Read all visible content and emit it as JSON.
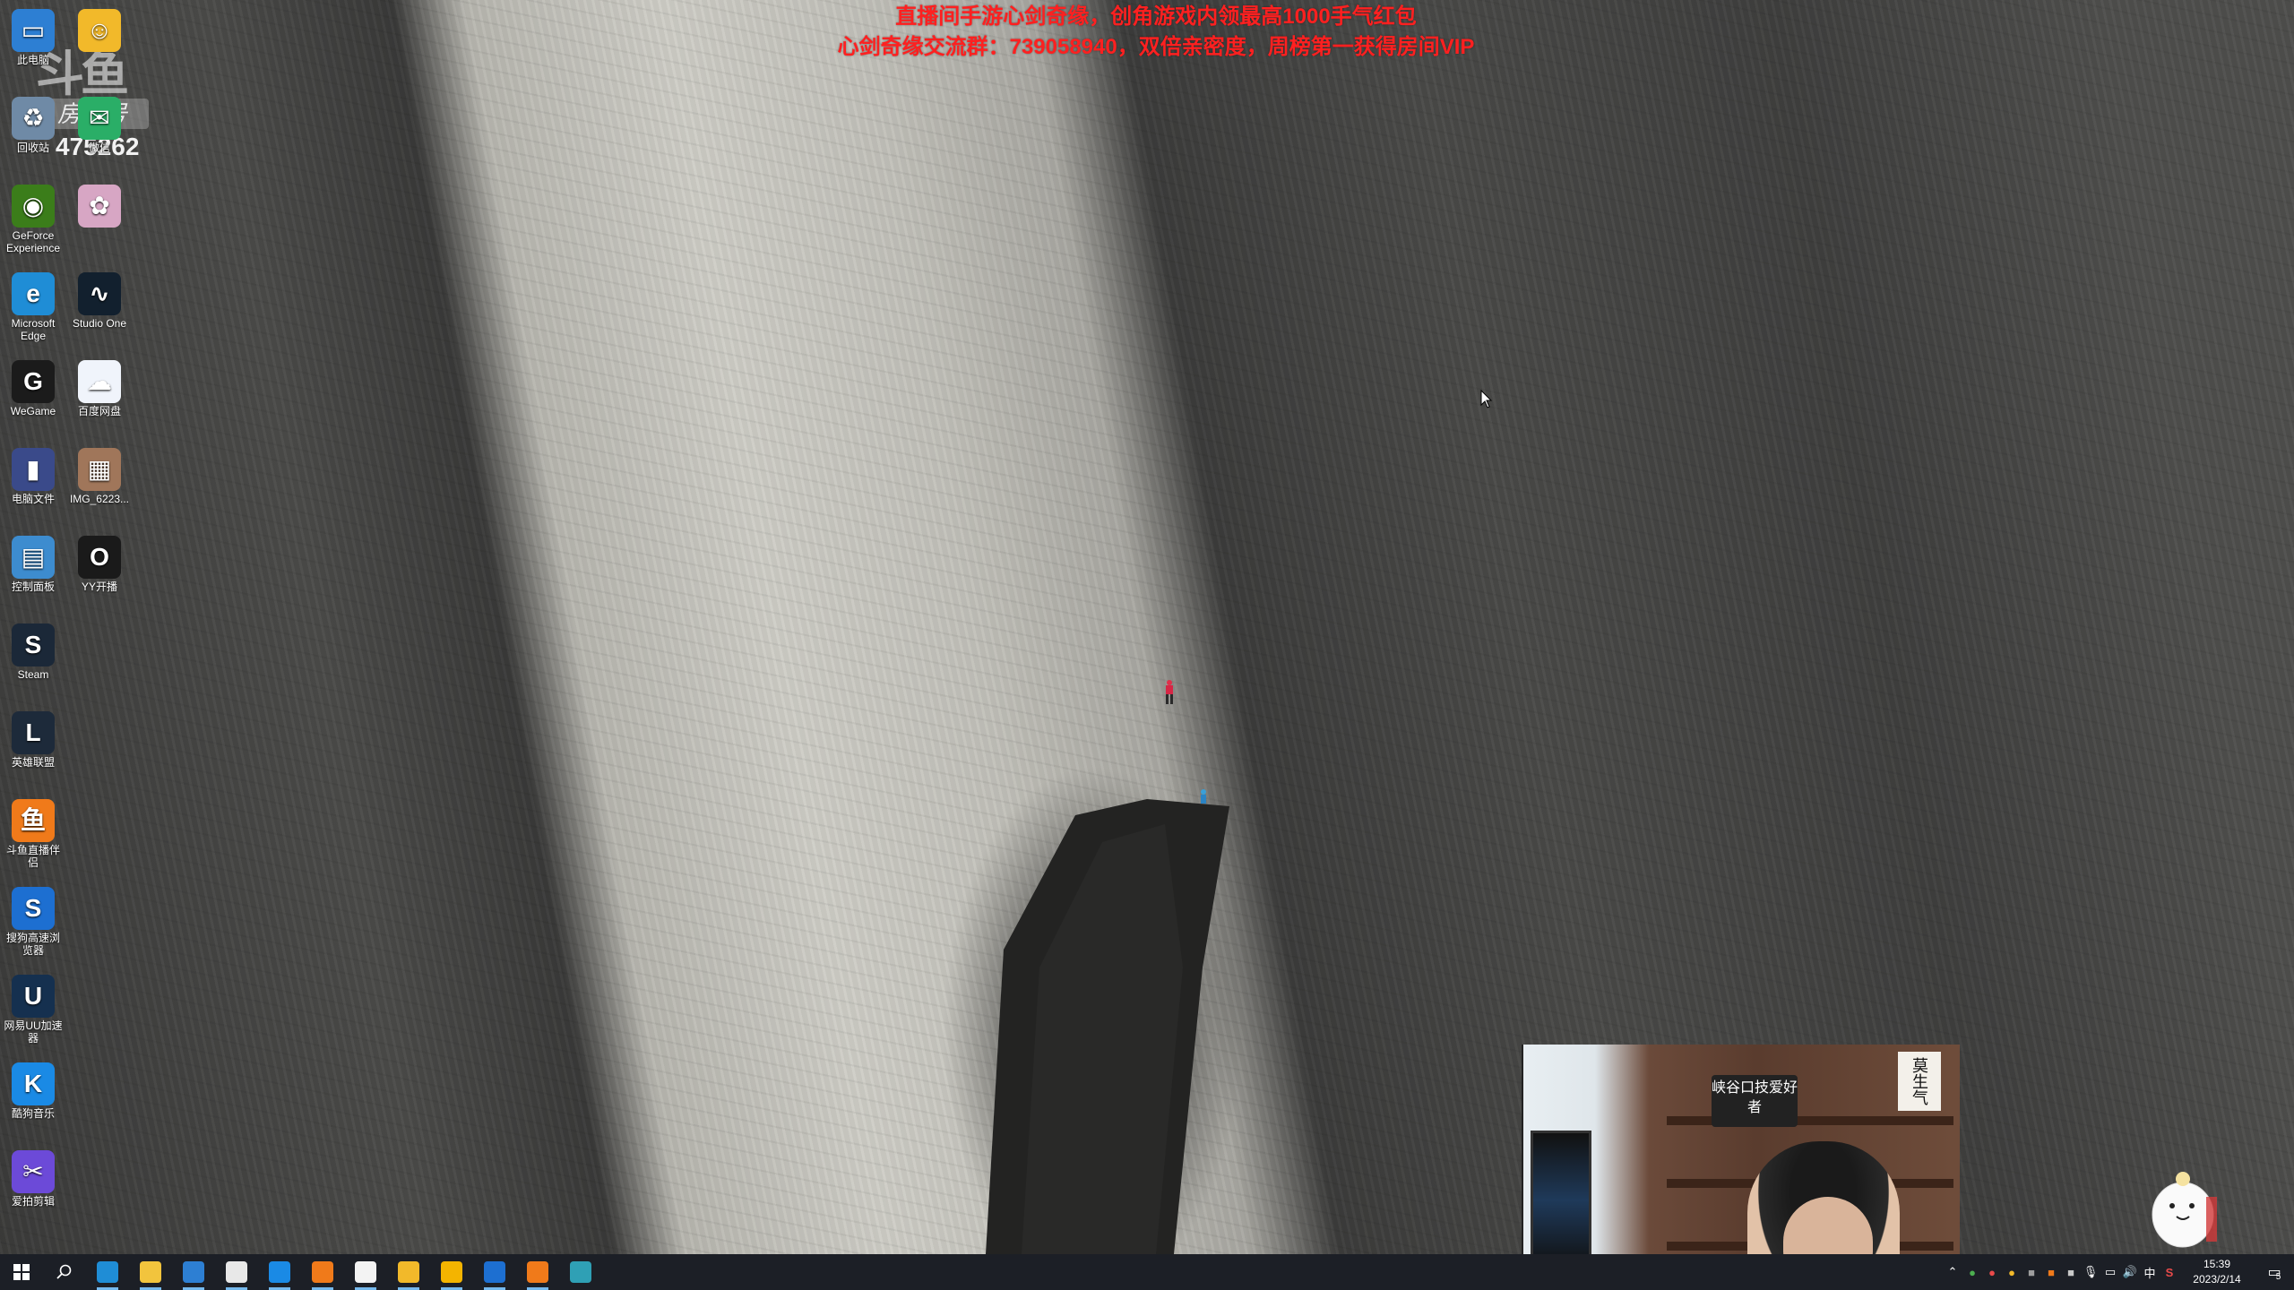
{
  "overlay": {
    "banner_line1": "直播间手游心剑奇缘，创角游戏内领最高1000手气红包",
    "banner_line2": "心剑奇缘交流群：739058940，双倍亲密度，周榜第一获得房间VIP",
    "room_logo": "斗鱼",
    "room_label": "房间号",
    "room_number": "475262"
  },
  "desktop_icons": [
    {
      "label": "此电脑",
      "icon": "computer-icon",
      "color": "#2d7fd3",
      "glyph": "▭"
    },
    {
      "label": "回收站",
      "icon": "recycle-bin-icon",
      "color": "#6f8aa6",
      "glyph": "♻"
    },
    {
      "label": "GeForce Experience",
      "icon": "nvidia-icon",
      "color": "#3b7d1a",
      "glyph": "◉"
    },
    {
      "label": "Microsoft Edge",
      "icon": "edge-icon",
      "color": "#1f8dd6",
      "glyph": "e"
    },
    {
      "label": "WeGame",
      "icon": "wegame-icon",
      "color": "#1b1b1b",
      "glyph": "G"
    },
    {
      "label": "电脑文件",
      "icon": "folder-icon",
      "color": "#3a4a8a",
      "glyph": "▮"
    },
    {
      "label": "控制面板",
      "icon": "control-panel-icon",
      "color": "#3d8ccf",
      "glyph": "▤"
    },
    {
      "label": "Steam",
      "icon": "steam-icon",
      "color": "#1b2838",
      "glyph": "S"
    },
    {
      "label": "英雄联盟",
      "icon": "league-icon",
      "color": "#1d2a3a",
      "glyph": "L"
    },
    {
      "label": "斗鱼直播伴侣",
      "icon": "douyu-companion-icon",
      "color": "#f07a1a",
      "glyph": "鱼"
    },
    {
      "label": "搜狗高速浏览器",
      "icon": "sogou-browser-icon",
      "color": "#1d6fd1",
      "glyph": "S"
    },
    {
      "label": "网易UU加速器",
      "icon": "uu-accelerator-icon",
      "color": "#15304f",
      "glyph": "U"
    },
    {
      "label": "酷狗音乐",
      "icon": "kugou-icon",
      "color": "#1a8ae5",
      "glyph": "K"
    },
    {
      "label": "爱拍剪辑",
      "icon": "aipai-editor-icon",
      "color": "#6c4ad8",
      "glyph": "✂"
    }
  ],
  "desktop_icons_col2": [
    {
      "label": "",
      "icon": "douyu-mascot-icon",
      "color": "#f2b92a",
      "glyph": "☺"
    },
    {
      "label": "微信",
      "icon": "wechat-icon",
      "color": "#2aae67",
      "glyph": "✉"
    },
    {
      "label": "",
      "icon": "anime-app-icon",
      "color": "#d7a6c4",
      "glyph": "✿"
    },
    {
      "label": "Studio One",
      "icon": "studio-one-icon",
      "color": "#12202e",
      "glyph": "∿"
    },
    {
      "label": "百度网盘",
      "icon": "baidu-netdisk-icon",
      "color": "#f0f4fb",
      "glyph": "☁"
    },
    {
      "label": "IMG_6223...",
      "icon": "image-file-icon",
      "color": "#a0765a",
      "glyph": "▦"
    },
    {
      "label": "YY开播",
      "icon": "yy-live-icon",
      "color": "#1a1a1a",
      "glyph": "O"
    }
  ],
  "taskbar": {
    "apps": [
      {
        "icon": "edge-icon",
        "color": "#1f8dd6"
      },
      {
        "icon": "file-explorer-icon",
        "color": "#f2c43d"
      },
      {
        "icon": "store-icon",
        "color": "#2d7fd3"
      },
      {
        "icon": "mail-icon",
        "color": "#e8e8e8"
      },
      {
        "icon": "kugou-icon",
        "color": "#1a8ae5"
      },
      {
        "icon": "douyu-app-icon",
        "color": "#f07a1a"
      },
      {
        "icon": "qq-icon",
        "color": "#f3f3f3"
      },
      {
        "icon": "douyu-mascot-icon",
        "color": "#f2b92a"
      },
      {
        "icon": "google-icon",
        "color": "#f4b400"
      },
      {
        "icon": "sogou-browser-icon",
        "color": "#1d6fd1"
      },
      {
        "icon": "douyu-companion-icon",
        "color": "#f07a1a"
      },
      {
        "icon": "studio-one-icon",
        "color": "#2fa0b5"
      }
    ],
    "tray": {
      "ime": "中",
      "time": "15:39",
      "date": "2023/2/14",
      "notification_count": "5"
    }
  },
  "webcam": {
    "sign_text": "峡谷口技爱好者",
    "card_text": "莫生气"
  }
}
